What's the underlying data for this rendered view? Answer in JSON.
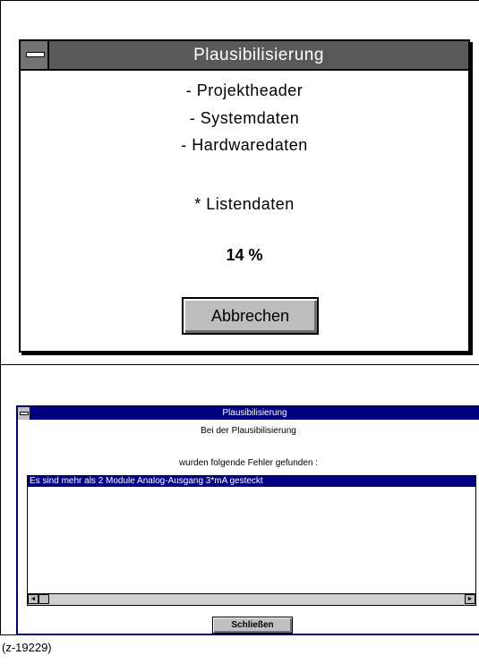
{
  "progress_dialog": {
    "title": "Plausibilisierung",
    "steps": [
      "- Projektheader",
      "- Systemdaten",
      "- Hardwaredaten"
    ],
    "current_step": "* Listendaten",
    "progress_text": "14 %",
    "cancel_label": "Abbrechen"
  },
  "error_dialog": {
    "title": "Plausibilisierung",
    "message_line1": "Bei der Plausibilisierung",
    "message_line2": "wurden folgende Fehler gefunden :",
    "errors": [
      "Es sind mehr als 2 Module Analog-Ausgang 3*mA gesteckt"
    ],
    "scroll_left_icon": "◄",
    "scroll_right_icon": "►",
    "close_label": "Schließen"
  },
  "caption": "(z-19229)"
}
